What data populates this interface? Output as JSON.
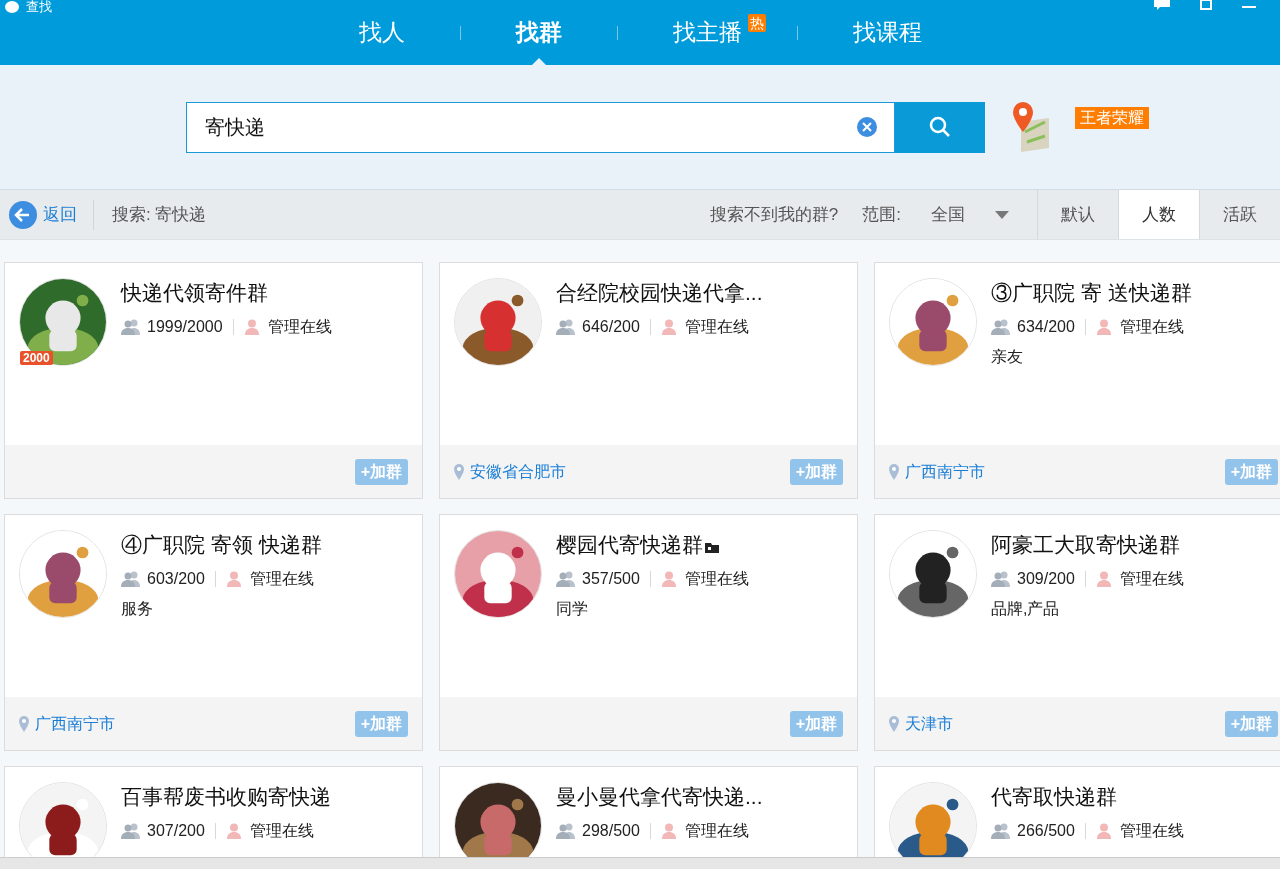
{
  "window": {
    "title": "查找"
  },
  "tabs": [
    {
      "label": "找人",
      "selected": false
    },
    {
      "label": "找群",
      "selected": true
    },
    {
      "label": "找主播",
      "selected": false,
      "badge": "热"
    },
    {
      "label": "找课程",
      "selected": false
    }
  ],
  "search": {
    "value": "寄快递",
    "game_tag": "王者荣耀"
  },
  "toolbar": {
    "back": "返回",
    "query": "搜索: 寄快递",
    "help": "搜索不到我的群?",
    "range_label": "范围:",
    "range_value": "全国",
    "sort": [
      {
        "label": "默认",
        "selected": false
      },
      {
        "label": "人数",
        "selected": true
      },
      {
        "label": "活跃",
        "selected": false
      }
    ]
  },
  "groups": [
    {
      "title": "快递代领寄件群",
      "members": "1999/2000",
      "admin": "管理在线",
      "badge": "2000",
      "join": "+加群"
    },
    {
      "title": "合经院校园快递代拿...",
      "members": "646/200",
      "admin": "管理在线",
      "location": "安徽省合肥市",
      "join": "+加群"
    },
    {
      "title": "③广职院 寄 送快递群",
      "members": "634/200",
      "admin": "管理在线",
      "tag": "亲友",
      "location": "广西南宁市",
      "join": "+加群"
    },
    {
      "title": "④广职院 寄领 快递群",
      "members": "603/200",
      "admin": "管理在线",
      "tag": "服务",
      "location": "广西南宁市",
      "join": "+加群"
    },
    {
      "title": "樱园代寄快递群",
      "members": "357/500",
      "admin": "管理在线",
      "tag": "同学",
      "title_icon": true,
      "join": "+加群"
    },
    {
      "title": "阿豪工大取寄快递群",
      "members": "309/200",
      "admin": "管理在线",
      "tag": "品牌,产品",
      "location": "天津市",
      "join": "+加群"
    },
    {
      "title": "百事帮废书收购寄快递",
      "members": "307/200",
      "admin": "管理在线"
    },
    {
      "title": "曼小曼代拿代寄快递...",
      "members": "298/500",
      "admin": "管理在线"
    },
    {
      "title": "代寄取快递群",
      "members": "266/500",
      "admin": "管理在线"
    }
  ]
}
